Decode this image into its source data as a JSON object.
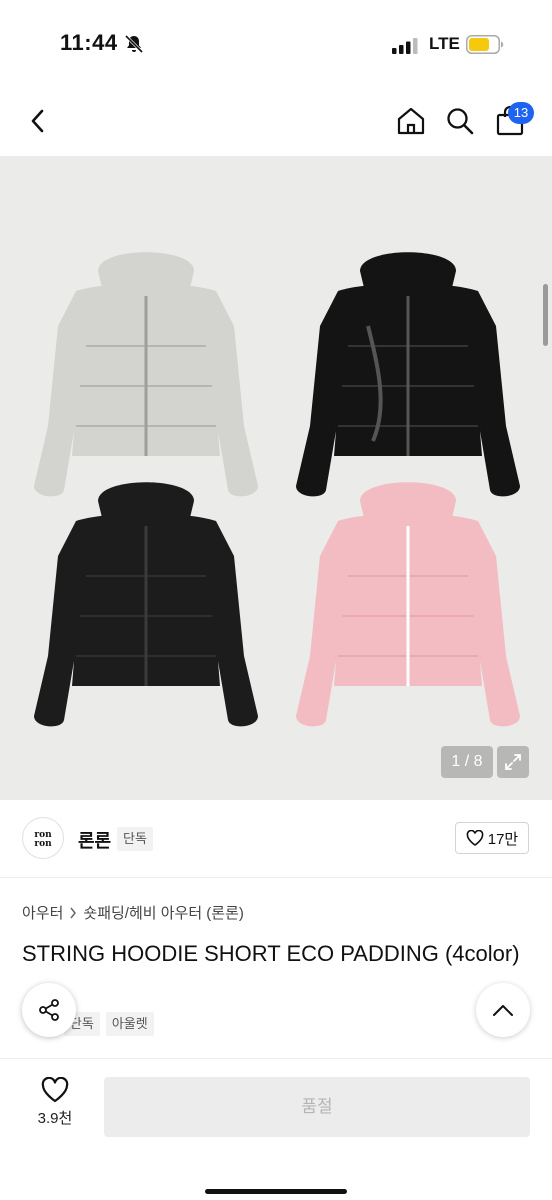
{
  "status_bar": {
    "time": "11:44",
    "network": "LTE"
  },
  "nav": {
    "cart_count": "13"
  },
  "gallery": {
    "page_indicator": "1 / 8",
    "jacket_colors": [
      "#d3d3d0",
      "#141414",
      "#1c1c1c",
      "#f2bcc2"
    ]
  },
  "brand": {
    "logo_text": "ron ron",
    "name": "론론",
    "tag": "단독",
    "likes": "17만"
  },
  "product": {
    "breadcrumb": [
      "아우터",
      "숏패딩/헤비 아우터 (론론)"
    ],
    "title": "STRING HOODIE SHORT ECO PADDING (4color)",
    "tags": [
      "단독",
      "아울렛"
    ]
  },
  "bottom": {
    "wish_count": "3.9천",
    "soldout_label": "품절"
  }
}
